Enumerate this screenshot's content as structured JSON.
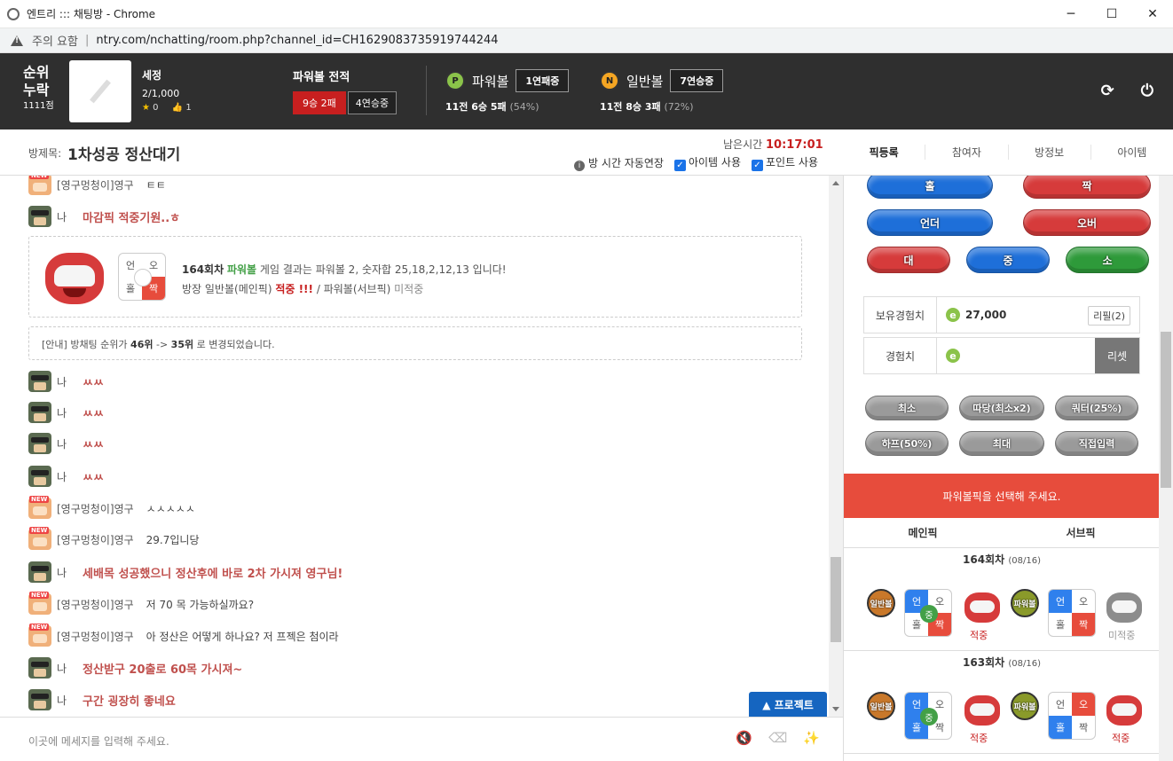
{
  "window": {
    "title": "엔트리 ::: 채팅방 - Chrome",
    "minimize": "─",
    "maximize": "☐",
    "close": "✕"
  },
  "address": {
    "warning": "주의 요함",
    "sep": "|",
    "url": "ntry.com/nchatting/room.php?channel_id=CH1629083735919744244"
  },
  "top": {
    "rank_label_1": "순위",
    "rank_label_2": "누락",
    "points": "1111점",
    "user_name": "세정",
    "level": "2/1,000",
    "stars": "0",
    "likes": "1",
    "power_record_title": "파워볼 전적",
    "power_record_win_loss": "9승 2패",
    "power_record_streak": "4연승중",
    "powerball": {
      "icon_letter": "P",
      "name": "파워볼",
      "streak": "1연패중",
      "stats": "11전 6승 5패",
      "pct": "(54%)"
    },
    "normalball": {
      "icon_letter": "N",
      "name": "일반볼",
      "streak": "7연승중",
      "stats": "11전 8승 3패",
      "pct": "(72%)"
    }
  },
  "room": {
    "title_label": "방제목:",
    "title": "1차성공 정산대기",
    "remaining_label": "남은시간",
    "remaining_time": "10:17:01",
    "auto_extend": "방 시간 자동연장",
    "item_use": "아이템 사용",
    "point_use": "포인트 사용"
  },
  "tabs": [
    "픽등록",
    "참여자",
    "방정보",
    "아이템"
  ],
  "chat": {
    "messages": [
      {
        "who": "[영구멍청이]영구",
        "text": "ㅌㅌ",
        "me": false
      },
      {
        "who": "나",
        "text": "마감픽 적중기원..ㅎ",
        "me": true
      },
      {
        "who": "나",
        "text": "ㅆㅆ",
        "me": true
      },
      {
        "who": "나",
        "text": "ㅆㅆ",
        "me": true
      },
      {
        "who": "나",
        "text": "ㅆㅆ",
        "me": true
      },
      {
        "who": "나",
        "text": "ㅆㅆ",
        "me": true
      },
      {
        "who": "[영구멍청이]영구",
        "text": "ㅅㅅㅅㅅㅅ",
        "me": false
      },
      {
        "who": "[영구멍청이]영구",
        "text": "29.7입니당",
        "me": false
      },
      {
        "who": "나",
        "text": "세배목 성공했으니 정산후에 바로 2차 가시져 영구님!",
        "me": true
      },
      {
        "who": "[영구멍청이]영구",
        "text": "저 70 목 가능하실까요?",
        "me": false
      },
      {
        "who": "[영구멍청이]영구",
        "text": "아 정산은 어떻게 하나요? 저 프젝은 첨이라",
        "me": false
      },
      {
        "who": "나",
        "text": "정산받구 20출로 60목 가시져~",
        "me": true
      },
      {
        "who": "나",
        "text": "구간 굉장히 좋네요",
        "me": true
      }
    ],
    "result": {
      "round": "164회차",
      "game": "파워볼",
      "part1": "게임 결과는 파워볼 2, 숫자합 25,18,2,12,13 입니다!",
      "line2_a": "방장 일반볼(메인픽)",
      "line2_hit": "적중 !!!",
      "line2_b": "/ 파워볼(서브픽)",
      "line2_miss": "미적중",
      "quad": [
        "언",
        "오",
        "홀",
        "짝"
      ]
    },
    "notice": {
      "prefix": "[안내] 방채팅 순위가",
      "from": "46위",
      "arrow": "->",
      "to": "35위",
      "suffix": "로 변경되었습니다."
    },
    "input_placeholder": "이곳에 메세지를 입력해 주세요.",
    "project_button": "▲ 프로젝트"
  },
  "side": {
    "buttons_row1": [
      "홀",
      "짝"
    ],
    "buttons_row2": [
      "언더",
      "오버"
    ],
    "buttons_row3": [
      "대",
      "중",
      "소"
    ],
    "exp_owned_label": "보유경험치",
    "exp_owned_value": "27,000",
    "refill": "리필(2)",
    "exp_label": "경험치",
    "reset": "리셋",
    "coin_letter": "e",
    "amount_buttons": [
      "최소",
      "따당(최소x2)",
      "쿼터(25%)",
      "하프(50%)",
      "최대",
      "직접입력"
    ],
    "banner": "파워볼픽을 선택해 주세요.",
    "main_pick": "메인픽",
    "sub_pick": "서브픽",
    "rounds": [
      {
        "title": "164회차",
        "date": "(08/16)",
        "main_type": "일반볼",
        "main_center": "중",
        "main_result": "적중",
        "sub_type": "파워볼",
        "sub_result": "미적중",
        "quad": [
          "언",
          "오",
          "홀",
          "짝"
        ]
      },
      {
        "title": "163회차",
        "date": "(08/16)",
        "main_type": "일반볼",
        "main_center": "중",
        "main_result": "적중",
        "sub_type": "파워볼",
        "sub_result": "적중",
        "quad": [
          "언",
          "오",
          "홀",
          "짝"
        ]
      }
    ]
  }
}
